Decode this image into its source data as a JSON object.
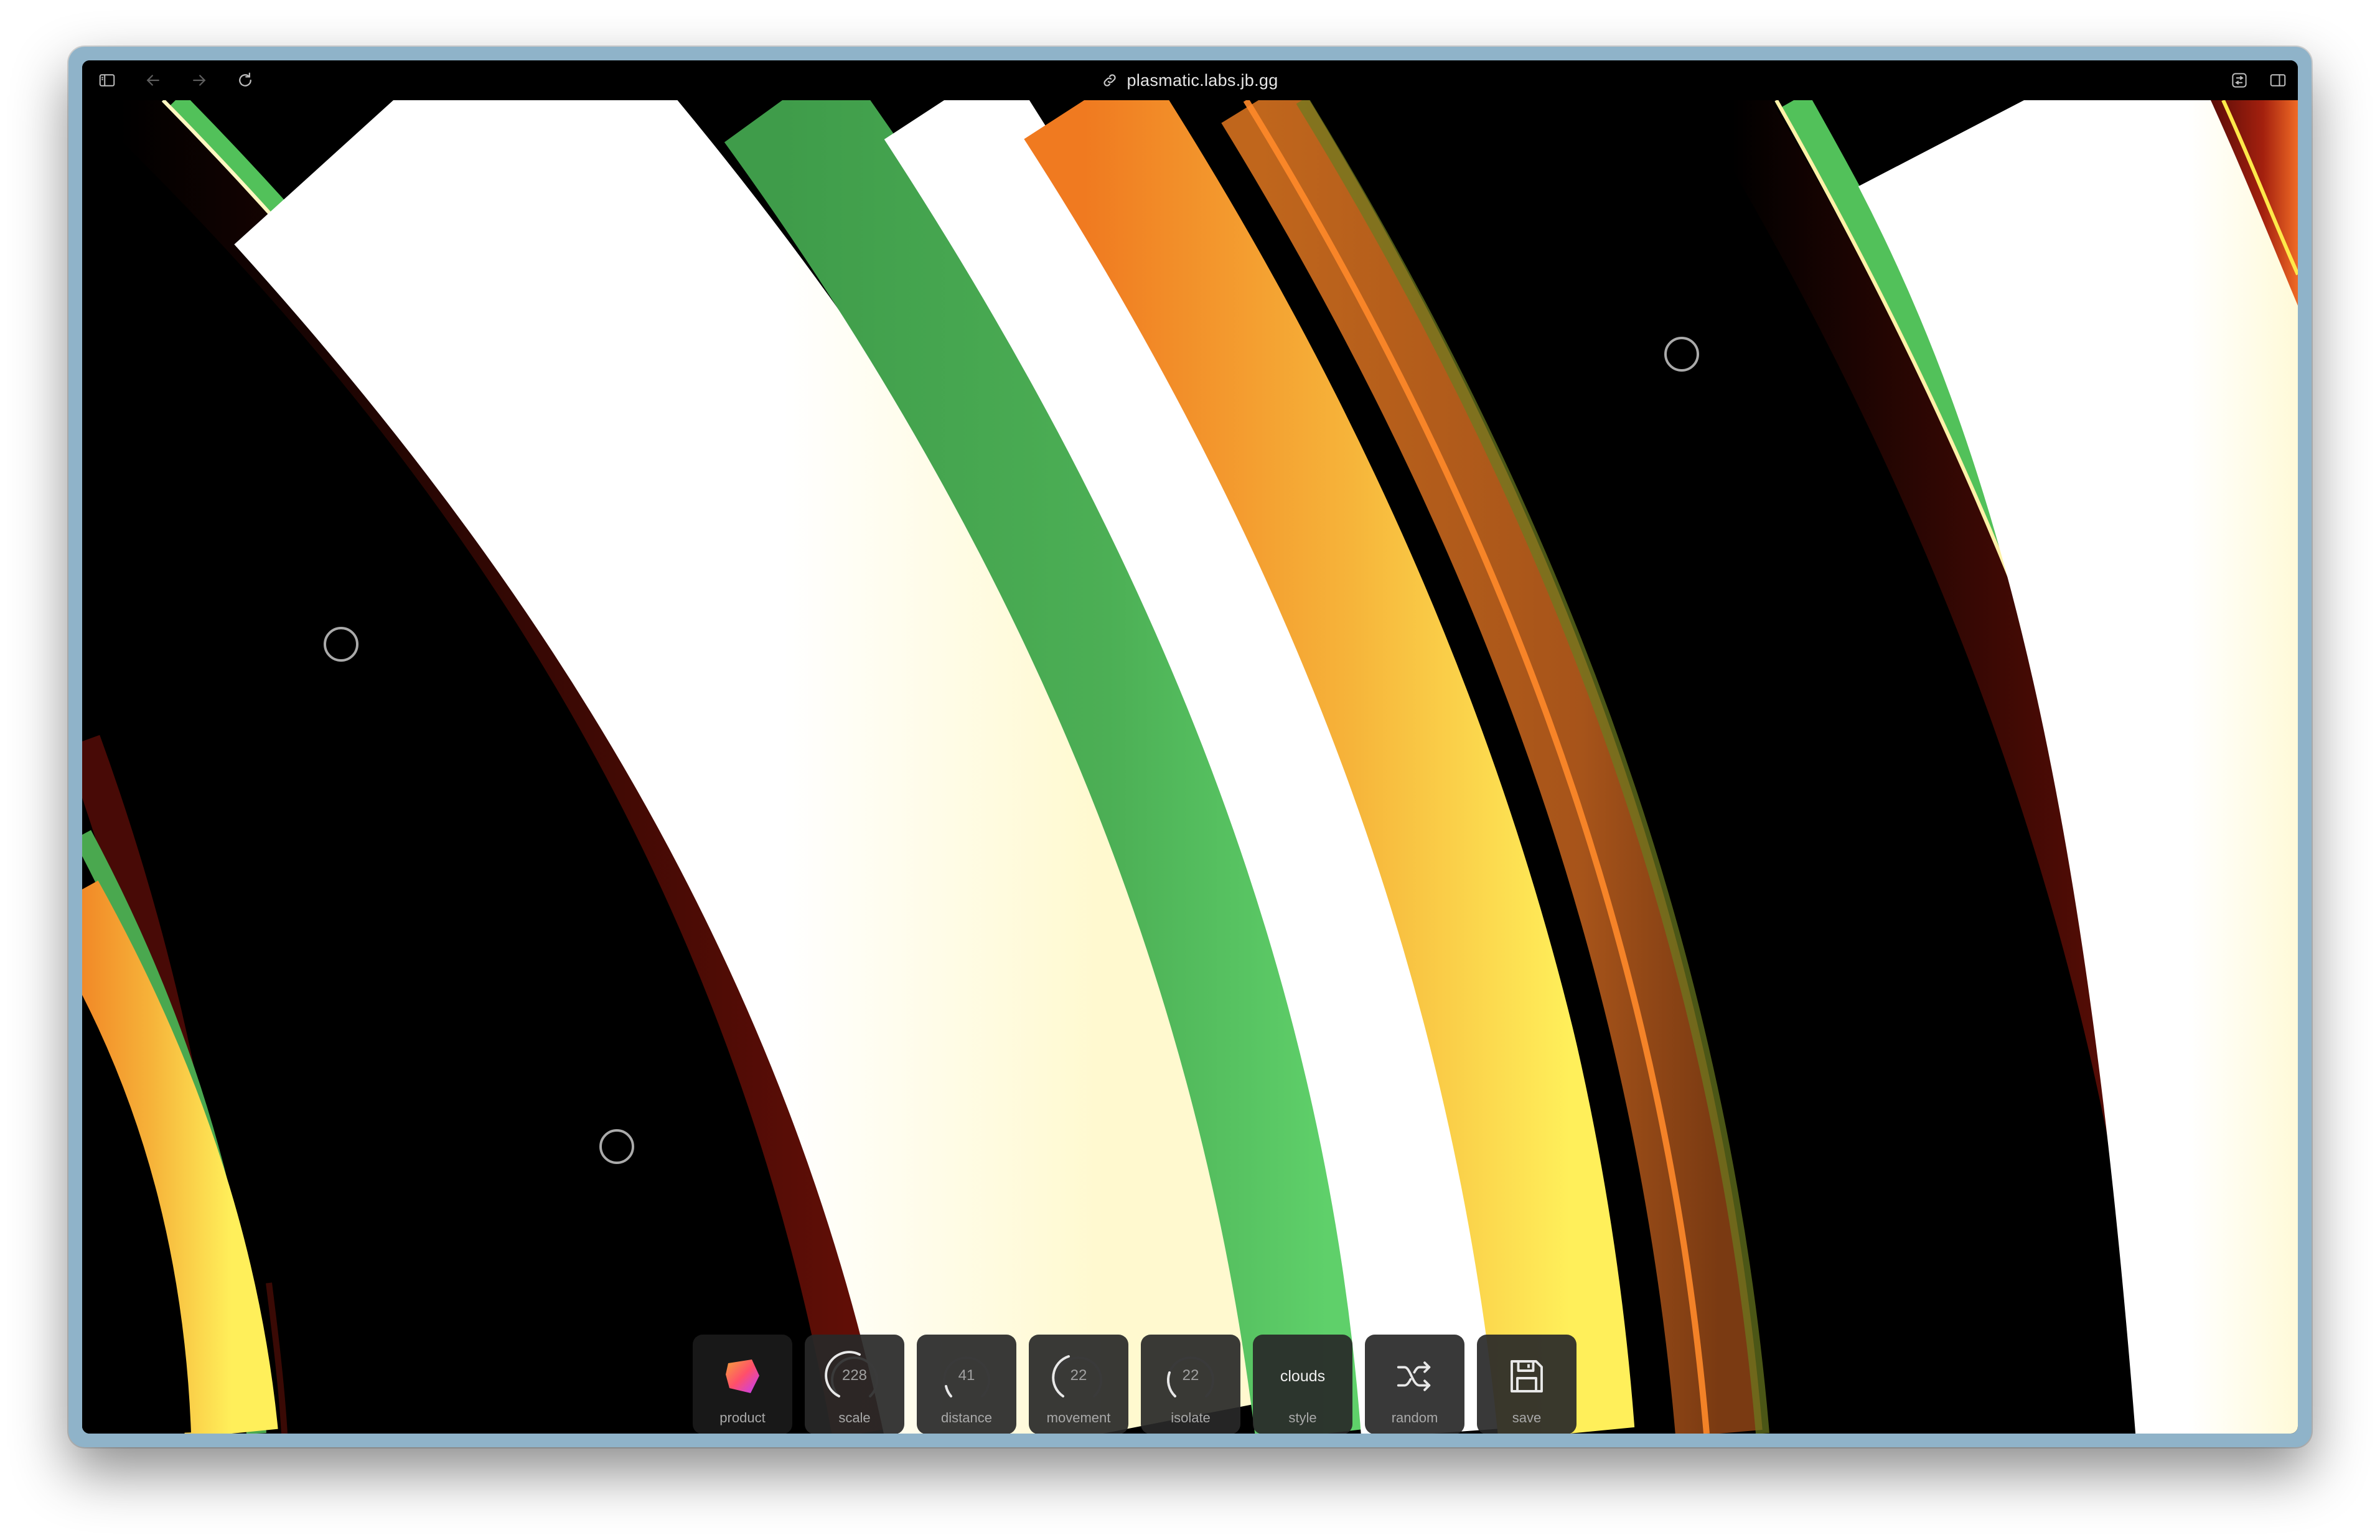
{
  "browser": {
    "url": "plasmatic.labs.jb.gg",
    "icons": [
      "sidebar-icon",
      "back-icon",
      "forward-icon",
      "reload-icon",
      "link-icon",
      "translate-icon",
      "split-view-icon"
    ]
  },
  "controls": {
    "product": {
      "label": "product",
      "icon": "product-logo-icon"
    },
    "scale": {
      "label": "scale",
      "value": "228",
      "level": 0.55
    },
    "distance": {
      "label": "distance",
      "value": "41",
      "level": 0.1
    },
    "movement": {
      "label": "movement",
      "value": "22",
      "level": 0.35
    },
    "isolate": {
      "label": "isolate",
      "value": "22",
      "level": 0.2
    },
    "style": {
      "label": "style",
      "value": "clouds"
    },
    "random": {
      "label": "random",
      "icon": "shuffle-icon"
    },
    "save": {
      "label": "save",
      "icon": "floppy-disk-icon"
    }
  },
  "colors": {
    "green": "#52c15a",
    "orange": "#f07a20",
    "yellow": "#ffe94a",
    "cream": "#fffbe6",
    "dark_red": "#5a0c08"
  }
}
